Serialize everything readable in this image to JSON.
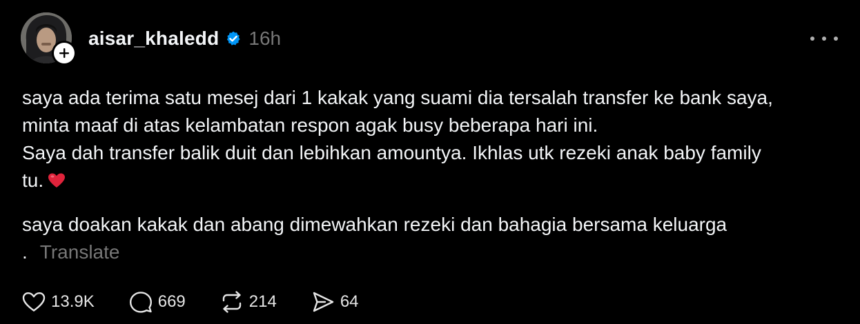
{
  "post": {
    "username": "aisar_khaledd",
    "time_ago": "16h",
    "body_lines": [
      "saya ada terima satu mesej dari 1 kakak yang suami dia tersalah transfer ke bank saya,",
      "minta maaf di atas kelambatan respon agak busy beberapa hari ini.",
      "Saya dah transfer balik duit dan lebihkan amountya. Ikhlas utk rezeki anak baby family",
      "tu."
    ],
    "body_emoji": "red-heart",
    "second_paragraph": "saya doakan kakak dan abang dimewahkan rezeki dan bahagia bersama keluarga",
    "trailing_dot": ".",
    "translate_label": "Translate"
  },
  "actions": {
    "likes": "13.9K",
    "comments": "669",
    "reposts": "214",
    "shares": "64"
  },
  "icons": {
    "verified": "verified-badge-icon",
    "more": "more-horizontal-icon",
    "like": "heart-icon",
    "comment": "comment-icon",
    "repost": "repost-icon",
    "share": "send-icon",
    "follow": "plus-icon"
  },
  "colors": {
    "background": "#000000",
    "text": "#f3f5f7",
    "muted": "#777777",
    "verified_blue": "#0095f6",
    "heart_red": "#e0233b"
  }
}
